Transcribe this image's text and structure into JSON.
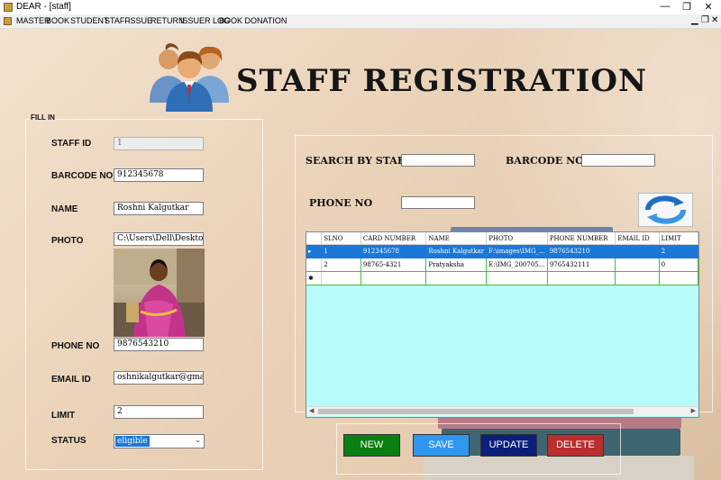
{
  "window": {
    "title": "DEAR - [staff]",
    "min_glyph": "—",
    "max_glyph": "❐",
    "close_glyph": "✕"
  },
  "menu": {
    "items": [
      "MASTER",
      "BOOK",
      "STUDENT",
      "STAFF",
      "ISSUE",
      "RETURN",
      "ISSUER LOG",
      "BOOK DONATION"
    ],
    "mdi_min": "▁",
    "mdi_restore": "❐",
    "mdi_close": "✕"
  },
  "page_title": "STAFF  REGISTRATION",
  "form": {
    "group_label": "FILL IN",
    "staff_id": {
      "label": "STAFF ID",
      "value": "1"
    },
    "barcode_no": {
      "label": "BARCODE NO",
      "value": "912345678"
    },
    "name": {
      "label": "NAME",
      "value": "Roshni Kalgutkar"
    },
    "photo": {
      "label": "PHOTO",
      "path": "C:\\Users\\Dell\\Desktop\\I"
    },
    "phone_no": {
      "label": "PHONE NO",
      "value": "9876543210"
    },
    "email_id": {
      "label": "EMAIL ID",
      "value": "oshnikalgutkar@gmail.com"
    },
    "limit": {
      "label": "LIMIT",
      "value": "2"
    },
    "status": {
      "label": "STATUS",
      "value": "eligible"
    }
  },
  "search": {
    "by_staff_label": "SEARCH BY STAFF",
    "barcode_label": "BARCODE NO",
    "phone_label": "PHONE NO",
    "refresh_icon": "refresh-icon"
  },
  "grid": {
    "columns": [
      "SLNO",
      "CARD NUMBER",
      "NAME",
      "PHOTO",
      "PHONE NUMBER",
      "EMAIL ID",
      "LIMIT"
    ],
    "rows": [
      [
        "1",
        "912345678",
        "Roshni Kalgutkar",
        "F:\\images\\IMG_...",
        "9876543210",
        "",
        "2"
      ],
      [
        "2",
        "98765-4321",
        "Pratyaksha",
        "E:\\IMG_200705...",
        "9765432111",
        "",
        "0"
      ]
    ],
    "row_indicator": "▸",
    "new_row_indicator": "✱"
  },
  "buttons": {
    "new": {
      "label": "NEW",
      "color": "#0a7f12"
    },
    "save": {
      "label": "SAVE",
      "color": "#2f97f0"
    },
    "update": {
      "label": "UPDATE",
      "color": "#0b1f7a"
    },
    "delete": {
      "label": "DELETE",
      "color": "#bb2e2e"
    }
  }
}
